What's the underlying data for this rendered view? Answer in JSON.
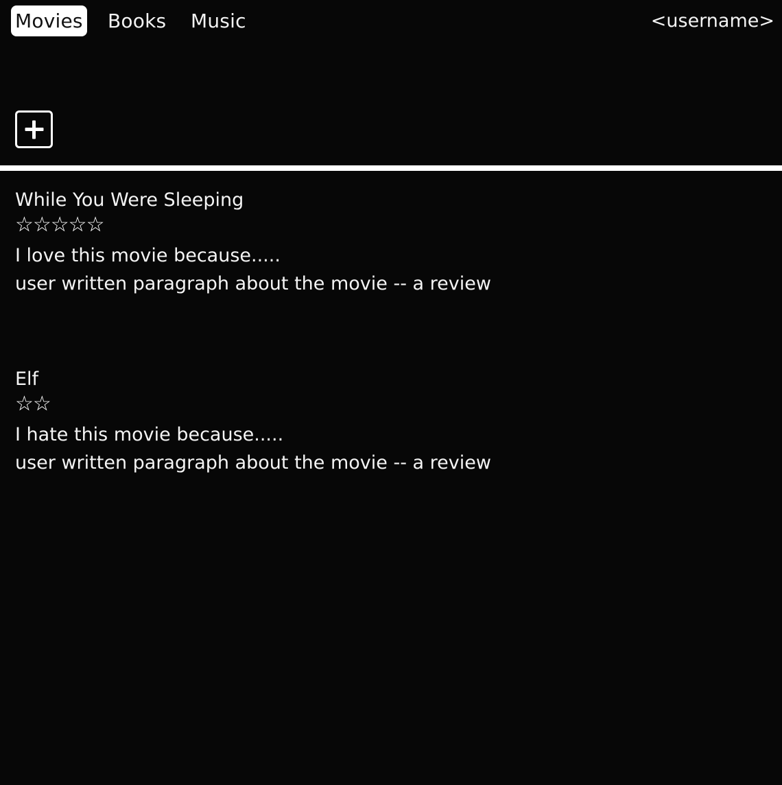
{
  "nav": {
    "tabs": [
      {
        "label": "Movies",
        "active": true
      },
      {
        "label": "Books",
        "active": false
      },
      {
        "label": "Music",
        "active": false
      }
    ],
    "username": "<username>"
  },
  "toolbar": {
    "add_icon": "plus-icon"
  },
  "reviews": [
    {
      "title": "While You Were Sleeping",
      "stars": "☆☆☆☆☆",
      "rating": 5,
      "line1": "I love this movie because.....",
      "line2": "user written paragraph about the movie -- a review"
    },
    {
      "title": "Elf",
      "stars": "☆☆",
      "rating": 2,
      "line1": "I hate this movie because.....",
      "line2": "user written paragraph about the movie -- a review"
    }
  ],
  "colors": {
    "background": "#070707",
    "foreground": "#ffffff",
    "active_tab_bg": "#ffffff",
    "active_tab_text": "#111111"
  }
}
